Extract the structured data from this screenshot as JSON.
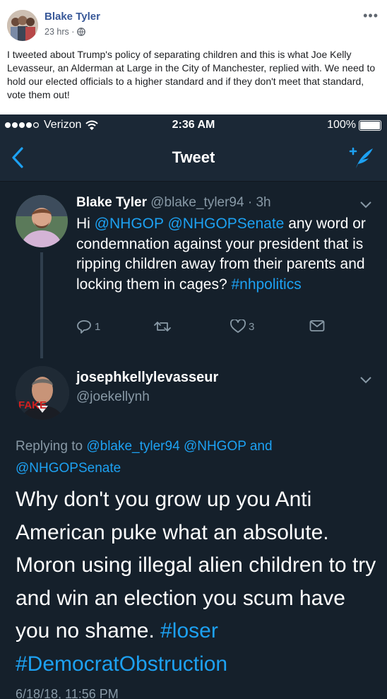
{
  "post": {
    "author": "Blake Tyler",
    "time": "23 hrs ·",
    "text": "I tweeted about Trump's policy of separating children and this is what Joe Kelly Levasseur, an Alderman at Large in the City of Manchester, replied with. We need to hold our elected officials to a higher standard and if they don't meet that standard, vote them out!",
    "icons": [
      "globe-icon",
      "more-options-icon"
    ]
  },
  "status_bar": {
    "carrier": "Verizon",
    "time": "2:36 AM",
    "battery": "100%",
    "battery_level": 1.0
  },
  "navbar": {
    "title": "Tweet",
    "icons": [
      "back-chevron-icon",
      "compose-tweet-icon"
    ]
  },
  "tweet1": {
    "name": "Blake Tyler",
    "handle_time": "@blake_tyler94 · 3h",
    "body_intro": "Hi ",
    "mention1": "@NHGOP",
    "mention2": "@NHGOPSenate",
    "body_main": " any word or condemnation against your president that is ripping children away from their parents and locking them in cages? ",
    "hashtag": "#nhpolitics",
    "reply_count": "1",
    "like_count": "3",
    "icons": [
      "reply-icon",
      "retweet-icon",
      "like-icon",
      "message-icon",
      "chevron-down-icon"
    ]
  },
  "tweet2": {
    "name": "josephkellylevasseur",
    "handle": "@joekellynh",
    "avatar_overlay": "FAKE",
    "replying_prefix": "Replying to ",
    "reply_mention1": "@blake_tyler94",
    "reply_mention2": "@NHGOP",
    "reply_and": " and ",
    "reply_mention3": "@NHGOPSenate",
    "body": "Why don't you grow up you Anti American puke what an absolute. Moron using illegal alien children to try and win an election you scum have you no shame. ",
    "hashtag1": "#loser",
    "hashtag2": "#DemocratObstruction",
    "date": "6/18/18, 11:56 PM"
  },
  "colors": {
    "facebook_link": "#385898",
    "twitter_bg": "#15202b",
    "twitter_link": "#1da1f2",
    "muted": "#8899a6"
  }
}
